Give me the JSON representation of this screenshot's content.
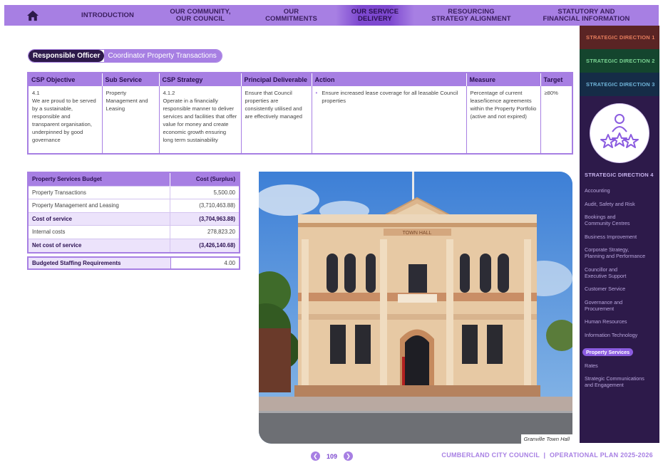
{
  "nav": {
    "items": [
      {
        "label_1": "INTRODUCTION",
        "label_2": ""
      },
      {
        "label_1": "OUR COMMUNITY,",
        "label_2": "OUR COUNCIL"
      },
      {
        "label_1": "OUR",
        "label_2": "COMMITMENTS"
      },
      {
        "label_1": "OUR SERVICE",
        "label_2": "DELIVERY"
      },
      {
        "label_1": "RESOURCING",
        "label_2": "STRATEGY ALIGNMENT"
      },
      {
        "label_1": "STATUTORY AND",
        "label_2": "FINANCIAL INFORMATION"
      }
    ],
    "home_icon": "home-icon"
  },
  "officer": {
    "label": "Responsible Officer",
    "value": "Coordinator Property Transactions"
  },
  "main_table": {
    "headers": [
      "CSP Objective",
      "Sub Service",
      "CSP Strategy",
      "Principal Deliverable",
      "Action",
      "Measure",
      "Target"
    ],
    "row": {
      "objective_code": "4.1",
      "objective_text": "We are proud to be served by a sustainable, responsible and transparent organisation, underpinned by good governance",
      "sub_service": "Property Management and Leasing",
      "strategy_code": "4.1.2",
      "strategy_text": "Operate in a financially responsible manner to deliver services and facilities that offer value for money and create economic growth ensuring long term sustainability",
      "deliverable": "Ensure that Council properties are consistently utilised and are effectively managed",
      "action": "Ensure increased lease coverage for all leasable Council properties",
      "measure": "Percentage of current lease/licence agreements within the Property Portfolio (active and not expired)",
      "target": "≥80%"
    }
  },
  "budget": {
    "header_label": "Property Services Budget",
    "header_value": "Cost (Surplus)",
    "rows": [
      {
        "label": "Property Transactions",
        "value": "5,500.00"
      },
      {
        "label": "Property Management and Leasing",
        "value": "(3,710,463.88)"
      },
      {
        "label": "Cost of service",
        "value": "(3,704,963.88)"
      },
      {
        "label": "Internal costs",
        "value": "278,823.20"
      },
      {
        "label": "Net cost of service",
        "value": "(3,426,140.68)"
      }
    ],
    "staffing_label": "Budgeted Staffing Requirements",
    "staffing_value": "4.00"
  },
  "photo": {
    "caption": "Granville Town Hall",
    "sign_text": "TOWN HALL"
  },
  "sidebar": {
    "directions": [
      "STRATEGIC DIRECTION 1",
      "STRATEGIC DIRECTION 2",
      "STRATEGIC DIRECTION 3"
    ],
    "direction4": "STRATEGIC DIRECTION 4",
    "items": [
      {
        "line1": "Accounting",
        "line2": ""
      },
      {
        "line1": "Audit, Safety and Risk",
        "line2": ""
      },
      {
        "line1": "Bookings and",
        "line2": "Community Centres"
      },
      {
        "line1": "Business Improvement",
        "line2": ""
      },
      {
        "line1": "Corporate Strategy,",
        "line2": "Planning and Performance"
      },
      {
        "line1": "Councillor and",
        "line2": "Executive Support"
      },
      {
        "line1": "Customer Service",
        "line2": ""
      },
      {
        "line1": "Governance and",
        "line2": "Procurement"
      },
      {
        "line1": "Human Resources",
        "line2": ""
      },
      {
        "line1": "Information Technology",
        "line2": ""
      },
      {
        "line1": "Property Services",
        "line2": ""
      },
      {
        "line1": "Rates",
        "line2": ""
      },
      {
        "line1": "Strategic Communications",
        "line2": "and Engagement"
      }
    ]
  },
  "footer": {
    "page": "109",
    "text": "CUMBERLAND CITY COUNCIL  |  OPERATIONAL PLAN 2025-2026"
  },
  "colors": {
    "accent": "#a77fe3",
    "dark": "#2d1a4a"
  }
}
